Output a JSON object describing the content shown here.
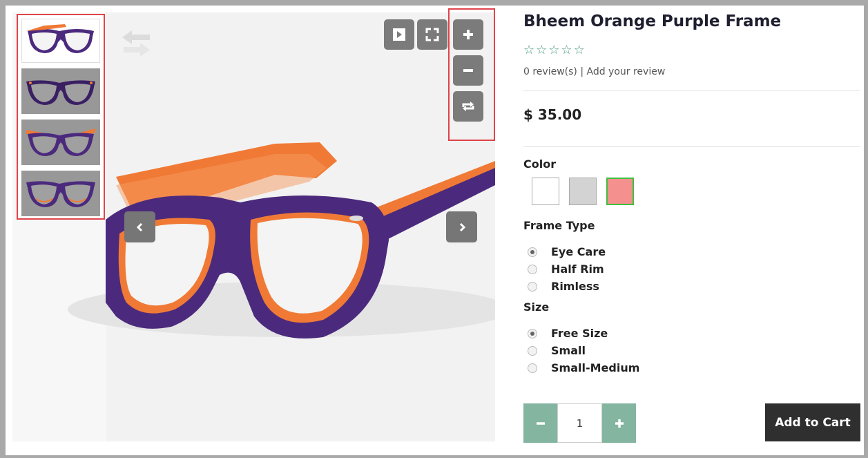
{
  "product": {
    "title": "Bheem Orange Purple Frame",
    "stars": [
      "☆",
      "☆",
      "☆",
      "☆",
      "☆"
    ],
    "rating_value": 0,
    "reviews_count": "0 review(s)",
    "reviews_separator": " | ",
    "add_review": "Add your review",
    "price": "$ 35.00"
  },
  "gallery": {
    "thumbnails": [
      {
        "label": "thumbnail-1",
        "active": true
      },
      {
        "label": "thumbnail-2",
        "active": false
      },
      {
        "label": "thumbnail-3",
        "active": false
      },
      {
        "label": "thumbnail-4",
        "active": false
      }
    ],
    "icons": {
      "play": "play-icon",
      "fullscreen": "fullscreen-icon",
      "zoom_in": "plus-icon",
      "zoom_out": "minus-icon",
      "reset": "repeat-icon",
      "prev": "chevron-left-icon",
      "next": "chevron-right-icon",
      "swap": "swap-arrows-icon"
    }
  },
  "options": {
    "color_label": "Color",
    "colors": [
      {
        "name": "white",
        "hex": "#ffffff",
        "selected": false
      },
      {
        "name": "gray",
        "hex": "#d3d3d3",
        "selected": false
      },
      {
        "name": "pink",
        "hex": "#f4918f",
        "selected": true
      }
    ],
    "frame_type_label": "Frame Type",
    "frame_types": [
      {
        "label": "Eye Care",
        "checked": true
      },
      {
        "label": "Half Rim",
        "checked": false
      },
      {
        "label": "Rimless",
        "checked": false
      }
    ],
    "size_label": "Size",
    "sizes": [
      {
        "label": "Free Size",
        "checked": true
      },
      {
        "label": "Small",
        "checked": false
      },
      {
        "label": "Small-Medium",
        "checked": false
      }
    ]
  },
  "cart": {
    "quantity": "1",
    "minus_label": "−",
    "plus_label": "+",
    "add_label": "Add to Cart"
  },
  "colors": {
    "accent_green": "#84b5a0",
    "highlight_red": "#e0434a",
    "frame_purple": "#4b2a7d",
    "frame_orange": "#f07a35"
  }
}
